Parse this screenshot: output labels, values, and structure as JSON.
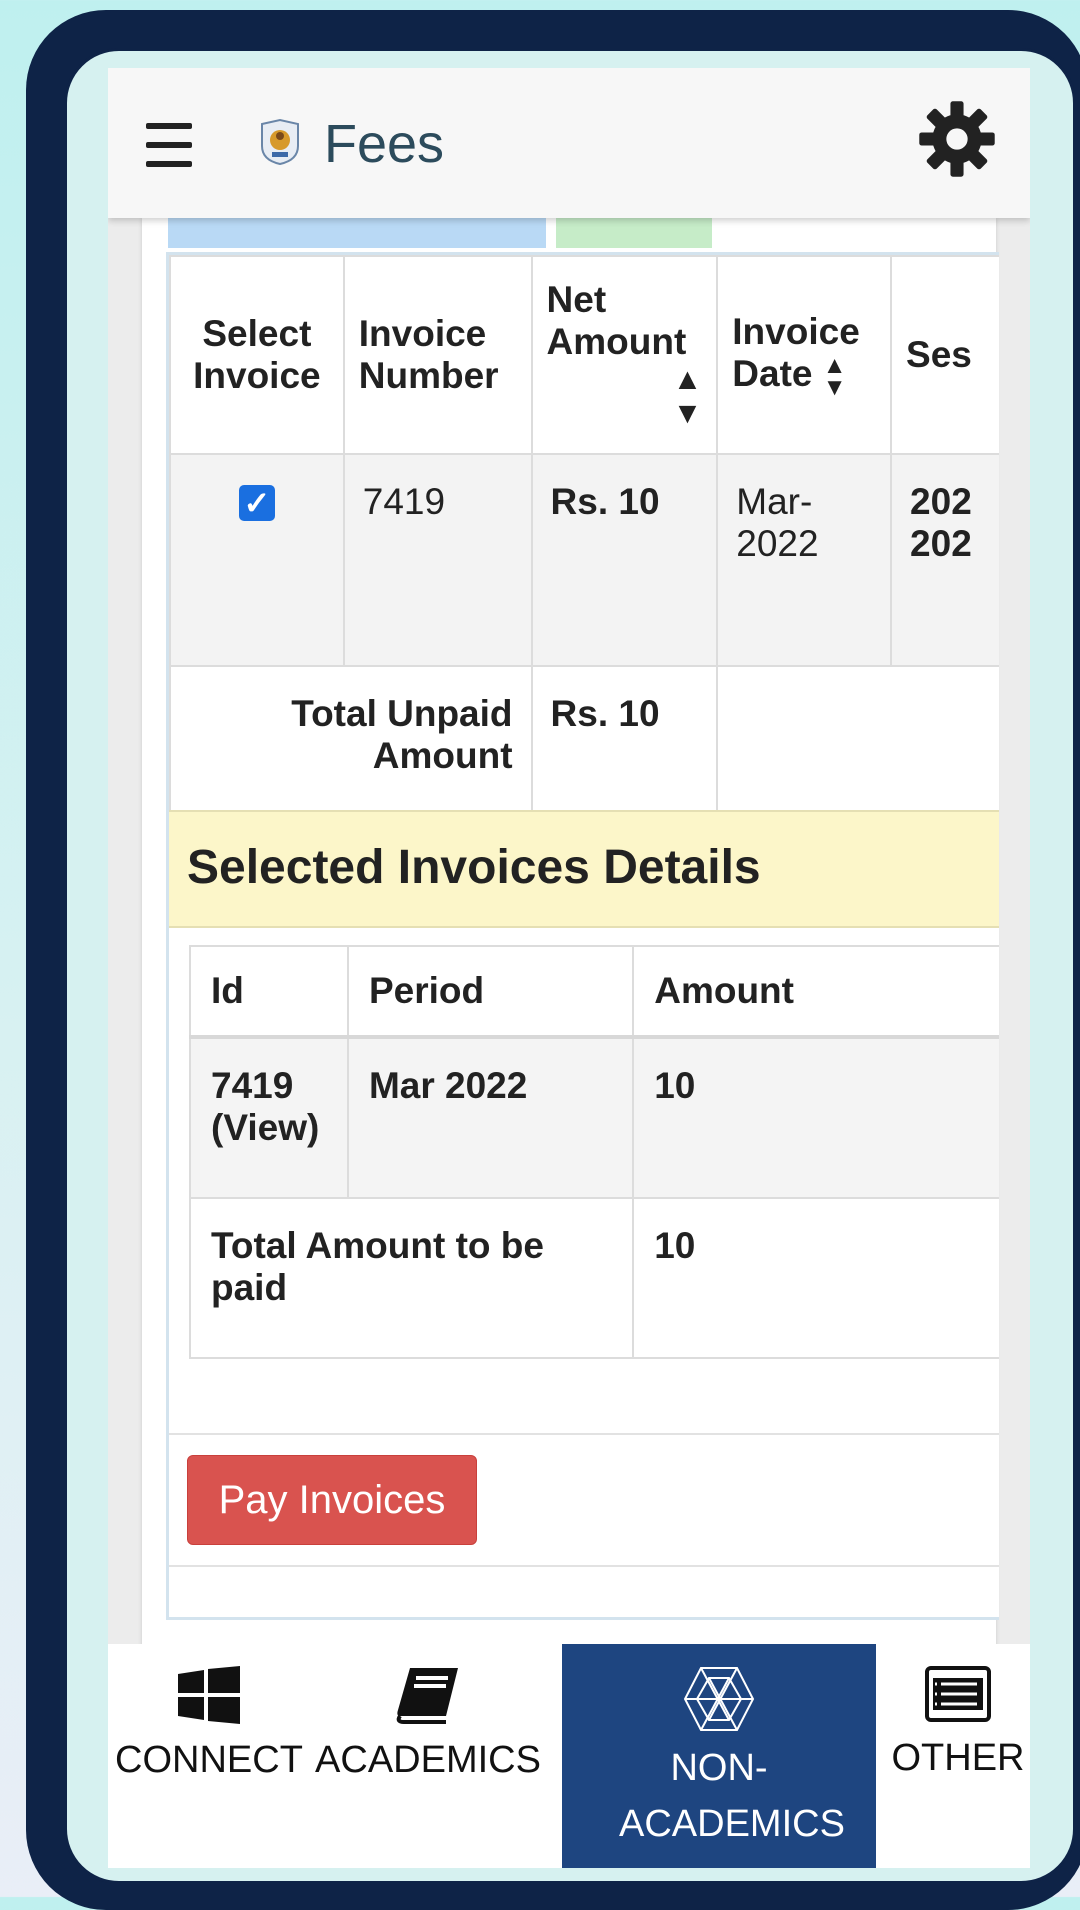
{
  "header": {
    "title": "Fees",
    "menu_icon": "hamburger-icon",
    "settings_icon": "gear-icon"
  },
  "invoices_table": {
    "columns": [
      "Select Invoice",
      "Invoice Number",
      "Net Amount",
      "Invoice Date",
      "Ses"
    ],
    "rows": [
      {
        "selected": true,
        "invoice_number": "7419",
        "net_amount": "Rs. 10",
        "invoice_date": "Mar-2022",
        "session_line1": "202",
        "session_line2": "202"
      }
    ],
    "total_label": "Total Unpaid Amount",
    "total_value": "Rs. 10"
  },
  "selected_details": {
    "title": "Selected Invoices Details",
    "columns": [
      "Id",
      "Period",
      "Amount"
    ],
    "rows": [
      {
        "id": "7419 (View)",
        "period": "Mar 2022",
        "amount": "10"
      }
    ],
    "total_label": "Total Amount to be paid",
    "total_value": "10"
  },
  "pay_button_label": "Pay Invoices",
  "bottom_nav": [
    {
      "label": "CONNECT",
      "icon": "windows-icon"
    },
    {
      "label": "ACADEMICS",
      "icon": "book-icon"
    },
    {
      "label": "NON-ACADEMICS",
      "icon": "polyhedron-icon",
      "active": true
    },
    {
      "label": "OTHER",
      "icon": "list-icon"
    }
  ],
  "colors": {
    "active_nav": "#1e4580",
    "pay_button": "#d9534f",
    "session_text": "#d40f0f",
    "checkbox": "#1a6fe0"
  }
}
